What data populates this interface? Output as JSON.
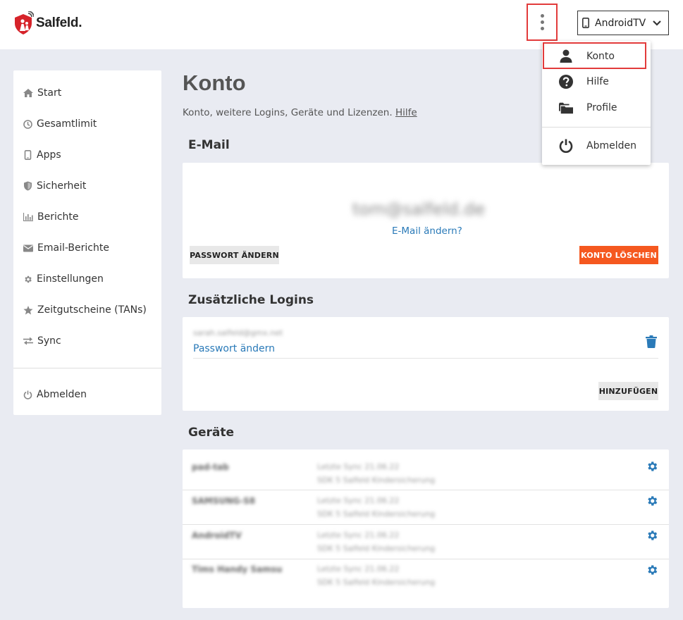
{
  "header": {
    "brand": "Salfeld.",
    "device_label": "AndroidTV"
  },
  "sidebar": {
    "items": [
      {
        "label": "Start",
        "icon": "home-icon"
      },
      {
        "label": "Gesamtlimit",
        "icon": "clock-icon"
      },
      {
        "label": "Apps",
        "icon": "phone-icon"
      },
      {
        "label": "Sicherheit",
        "icon": "shield-icon"
      },
      {
        "label": "Berichte",
        "icon": "bar-chart-icon"
      },
      {
        "label": "Email-Berichte",
        "icon": "envelope-icon"
      },
      {
        "label": "Einstellungen",
        "icon": "gear-icon"
      },
      {
        "label": "Zeitgutscheine (TANs)",
        "icon": "star-icon"
      },
      {
        "label": "Sync",
        "icon": "exchange-icon"
      }
    ],
    "logout_label": "Abmelden"
  },
  "page": {
    "title": "Konto",
    "description": "Konto, weitere Logins, Geräte und Lizenzen.",
    "help_link": "Hilfe"
  },
  "email_section": {
    "title": "E-Mail",
    "email_value": "tom@salfeld.de",
    "change_email_link": "E-Mail ändern?",
    "change_password_button": "PASSWORT ÄNDERN",
    "delete_account_button": "KONTO LÖSCHEN"
  },
  "logins_section": {
    "title": "Zusätzliche Logins",
    "login_email": "sarah.salfeld@gmx.net",
    "change_password_link": "Passwort ändern",
    "add_button": "HINZUFÜGEN"
  },
  "devices_section": {
    "title": "Geräte",
    "devices": [
      {
        "name": "pad-tab",
        "line1": "Letzte Sync 21.06.22",
        "line2": "SDK 5 Salfeld Kindersicherung"
      },
      {
        "name": "SAMSUNG-S8",
        "line1": "Letzte Sync 21.06.22",
        "line2": "SDK 5 Salfeld Kindersicherung"
      },
      {
        "name": "AndroidTV",
        "line1": "Letzte Sync 21.06.22",
        "line2": "SDK 5 Salfeld Kindersicherung"
      },
      {
        "name": "Tims Handy Samsu",
        "line1": "Letzte Sync 21.06.22",
        "line2": "SDK 5 Salfeld Kindersicherung"
      }
    ]
  },
  "dropdown": {
    "items": [
      {
        "label": "Konto",
        "icon": "user-icon"
      },
      {
        "label": "Hilfe",
        "icon": "question-circle-icon"
      },
      {
        "label": "Profile",
        "icon": "folder-icon"
      },
      {
        "label": "Abmelden",
        "icon": "power-icon"
      }
    ]
  },
  "colors": {
    "accent_blue": "#2a7ab8",
    "danger_orange": "#f5581f",
    "highlight_red": "#e23b3b",
    "brand_red": "#d6232a"
  }
}
